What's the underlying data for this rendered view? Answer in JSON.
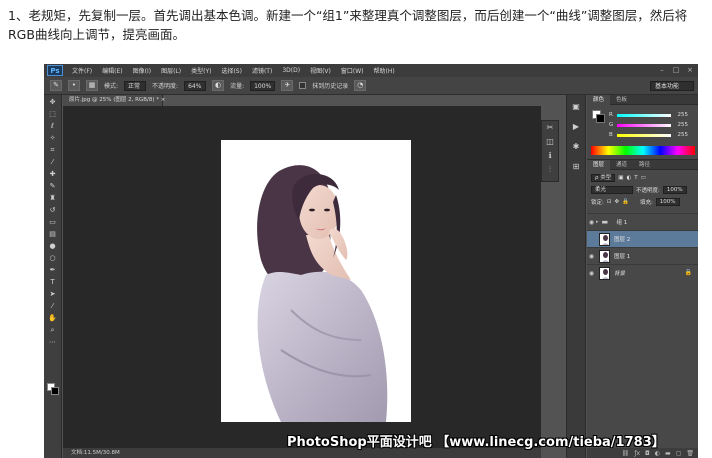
{
  "article": {
    "text": "1、老规矩，先复制一层。首先调出基本色调。新建一个“组1”来整理真个调整图层，而后创建一个“曲线”调整图层，然后将RGB曲线向上调节，提亮画面。"
  },
  "app": {
    "logo": "Ps",
    "menu": [
      "文件(F)",
      "编辑(E)",
      "图像(I)",
      "图层(L)",
      "类型(Y)",
      "选择(S)",
      "滤镜(T)",
      "3D(D)",
      "视图(V)",
      "窗口(W)",
      "帮助(H)"
    ],
    "window_controls": [
      "–",
      "□",
      "×"
    ]
  },
  "options": {
    "mode_label": "模式:",
    "mode_value": "正常",
    "opacity_label": "不透明度:",
    "opacity_value": "64%",
    "flow_label": "流量:",
    "flow_value": "100%",
    "history_label": "抹到历史记录",
    "workspace": "基本功能"
  },
  "document": {
    "tab": "原片.jpg @ 25% (图层 2, RGB/8) *  ×",
    "status": "文档:11.5M/30.8M"
  },
  "panels": {
    "color_tabs": [
      "颜色",
      "色板"
    ],
    "channels": [
      {
        "label": "R",
        "value": "255",
        "color": "#ff3b3b"
      },
      {
        "label": "G",
        "value": "255",
        "color": "#3bff3b"
      },
      {
        "label": "B",
        "value": "255",
        "color": "#3b6bff"
      }
    ],
    "layer_tabs": [
      "图层",
      "通道",
      "路径"
    ],
    "filter_label": "ρ 类型",
    "blend_mode": "柔光",
    "opacity_label": "不透明度:",
    "opacity_value": "100%",
    "lock_label": "锁定:",
    "fill_label": "填充:",
    "fill_value": "100%",
    "layers": [
      {
        "name": "组 1",
        "type": "group",
        "selected": false
      },
      {
        "name": "图层 2",
        "type": "pixel",
        "selected": true
      },
      {
        "name": "图层 1",
        "type": "pixel",
        "selected": false
      },
      {
        "name": "背景",
        "type": "background",
        "selected": false
      }
    ]
  },
  "watermark": {
    "text": "PhotoShop平面设计吧 【www.linecg.com/tieba/1783】"
  }
}
